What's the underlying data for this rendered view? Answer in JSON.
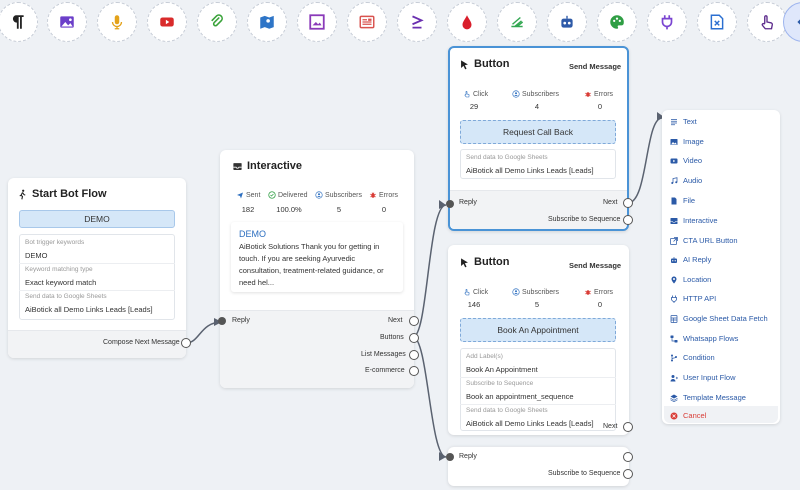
{
  "toolbar": {
    "items": [
      "paragraph-icon",
      "image-icon",
      "microphone-icon",
      "video-icon",
      "paperclip-icon",
      "map-icon",
      "media-frame-icon",
      "newspaper-icon",
      "greater-equal-icon",
      "droplet-icon",
      "api-hook-icon",
      "robot-icon",
      "palette-icon",
      "plug-icon",
      "excel-icon",
      "pointer-hand-icon",
      "back-arrow-icon"
    ],
    "colors": {
      "paragraph": "#222222",
      "image": "#6b3fc9",
      "microphone": "#e3a21a",
      "video": "#d92b2b",
      "paperclip": "#3aa33a",
      "map": "#2e75c7",
      "media": "#8a3ab9",
      "newspaper": "#d9534f",
      "ge": "#6a2fb0",
      "droplet": "#d91e2b",
      "api": "#34a853",
      "robot": "#2e5aa8",
      "palette": "#2f9e44",
      "plug": "#7a45d1",
      "excel": "#2b6fd1",
      "pointer": "#5c2a8c",
      "back": "#2b5aa7"
    }
  },
  "start": {
    "title": "Start Bot Flow",
    "button": "DEMO",
    "trigger_label": "Bot trigger keywords",
    "trigger_value": "DEMO",
    "match_label": "Keyword matching type",
    "match_value": "Exact keyword match",
    "sheets_label": "Send data to Google Sheets",
    "sheets_value": "AiBotick all Demo Links Leads [Leads]",
    "compose": "Compose Next Message"
  },
  "interactive": {
    "title": "Interactive",
    "stats": [
      {
        "label": "Sent",
        "value": "182"
      },
      {
        "label": "Delivered",
        "value": "100.0%"
      },
      {
        "label": "Subscribers",
        "value": "5"
      },
      {
        "label": "Errors",
        "value": "0"
      }
    ],
    "demo": "DEMO",
    "message": "AiBotick Solutions Thank you for getting in touch. If you are seeking Ayurvedic consultation, treatment-related guidance, or need hel...",
    "reply": "Reply",
    "next": "Next",
    "buttons": "Buttons",
    "list": "List Messages",
    "ecommerce": "E-commerce"
  },
  "button1": {
    "title": "Button",
    "send": "Send Message",
    "stats": [
      {
        "label": "Click",
        "value": "29"
      },
      {
        "label": "Subscribers",
        "value": "4"
      },
      {
        "label": "Errors",
        "value": "0"
      }
    ],
    "action": "Request Call Back",
    "sheets_label": "Send data to Google Sheets",
    "sheets_value": "AiBotick all Demo Links Leads [Leads]",
    "reply": "Reply",
    "next": "Next",
    "subscribe": "Subscribe to Sequence"
  },
  "button2": {
    "title": "Button",
    "send": "Send Message",
    "stats": [
      {
        "label": "Click",
        "value": "146"
      },
      {
        "label": "Subscribers",
        "value": "5"
      },
      {
        "label": "Errors",
        "value": "0"
      }
    ],
    "action": "Book An Appointment",
    "label_label": "Add Label(s)",
    "label_value": "Book An Appointment",
    "seq_label": "Subscribe to Sequence",
    "seq_value": "Book an appointment_sequence",
    "sheets_label": "Send data to Google Sheets",
    "sheets_value": "AiBotick all Demo Links Leads [Leads]",
    "next": "Next",
    "reply": "Reply",
    "subscribe": "Subscribe to Sequence"
  },
  "menu": {
    "items": [
      "Text",
      "Image",
      "Video",
      "Audio",
      "File",
      "Interactive",
      "CTA URL Button",
      "AI Reply",
      "Location",
      "HTTP API",
      "Google Sheet Data Fetch",
      "Whatsapp Flows",
      "Condition",
      "User Input Flow",
      "Template Message"
    ],
    "cancel": "Cancel"
  }
}
